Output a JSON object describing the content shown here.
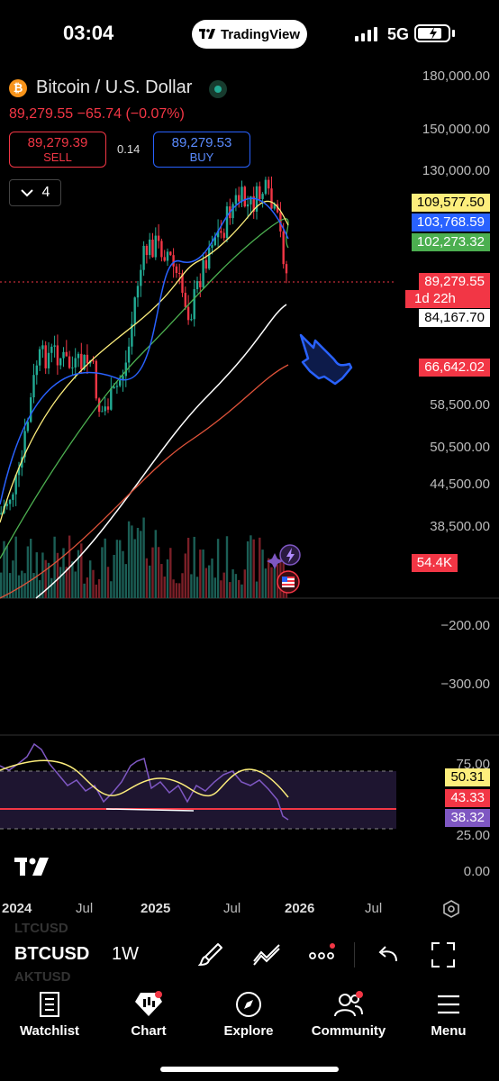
{
  "status": {
    "time": "03:04",
    "app_pill": "TradingView",
    "network": "5G"
  },
  "header": {
    "title": "Bitcoin / U.S. Dollar",
    "price_line": "89,279.55  −65.74 (−0.07%)",
    "sell_price": "89,279.39",
    "sell_label": "SELL",
    "spread": "0.14",
    "buy_price": "89,279.53",
    "buy_label": "BUY",
    "indicator_count": "4"
  },
  "price_axis": [
    "180,000.00",
    "150,000.00",
    "130,000.00",
    "58,500.00",
    "50,500.00",
    "44,500.00",
    "38,500.00"
  ],
  "price_tags": {
    "ma_yellow": "109,577.50",
    "ma_blue": "103,768.59",
    "ma_green": "102,273.32",
    "last_price": "89,279.55",
    "countdown": "1d 22h",
    "ma_white": "84,167.70",
    "ma_red": "66,642.02",
    "volume": "54.4K"
  },
  "indicator_axis": [
    "−200.00",
    "−300.00"
  ],
  "rsi_axis": [
    "75.00",
    "25.00",
    "0.00"
  ],
  "rsi_tags": {
    "yellow": "50.31",
    "red": "43.33",
    "purple": "38.32"
  },
  "time_axis": [
    {
      "label": "2024",
      "bold": true
    },
    {
      "label": "Jul",
      "bold": false
    },
    {
      "label": "2025",
      "bold": true
    },
    {
      "label": "Jul",
      "bold": false
    },
    {
      "label": "2026",
      "bold": true
    },
    {
      "label": "Jul",
      "bold": false
    }
  ],
  "toolbar": {
    "watchlist_above": "LTCUSD",
    "symbol": "BTCUSD",
    "watchlist_below": "AKTUSD",
    "timeframe": "1W"
  },
  "tabs": {
    "watchlist": "Watchlist",
    "chart": "Chart",
    "explore": "Explore",
    "community": "Community",
    "menu": "Menu"
  },
  "colors": {
    "down": "#f23645",
    "up": "#22ab94",
    "ma_yellow": "#fdee7c",
    "ma_blue": "#2962ff",
    "ma_green": "#4caf50",
    "ma_red": "#e0533a",
    "rsi": "#7e57c2"
  }
}
